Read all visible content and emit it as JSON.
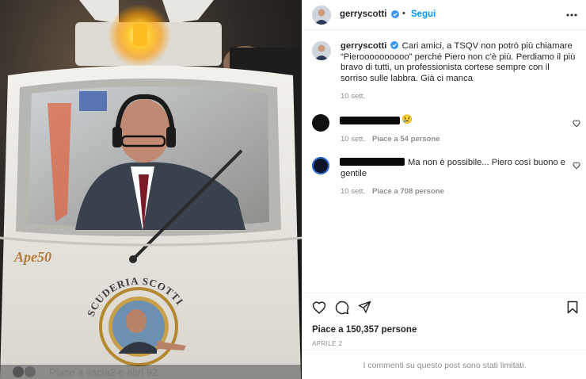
{
  "post": {
    "username": "gerryscotti",
    "follow_label": "Segui",
    "dot": "•",
    "verified": true,
    "icons": {
      "verified": "verified-badge-icon",
      "more": "more-options-icon"
    }
  },
  "caption": {
    "username": "gerryscotti",
    "text": "Cari amici, a TSQV non potrò più chiamare “Pieroooooooooo” perché Piero non c’è più. Perdiamo il più bravo di tutti, un professionista cortese sempre con il sorriso sulle labbra. Già ci manca",
    "time": "10 sett."
  },
  "comments": [
    {
      "emoji": "😢",
      "text": "",
      "time": "10 sett.",
      "likes": "Piace a 54 persone"
    },
    {
      "emoji": "",
      "text": "Ma non è possibile... Piero così buono e gentile",
      "time": "10 sett.",
      "likes": "Piace a 708 persone"
    }
  ],
  "actions": {
    "icons": [
      "heart-icon",
      "comment-icon",
      "share-icon",
      "bookmark-icon"
    ]
  },
  "stats": {
    "likes": "Piace a 150,357 persone",
    "date": "APRILE 2"
  },
  "limited_notice": "I commenti su questo post sono stati limitati.",
  "photo": {
    "vehicle_text_model": "Ape50",
    "vehicle_text_brand": "SCUDERIA SCOTTI",
    "overlay_text": "Piace a iiacia2 e altri 92"
  },
  "colors": {
    "accent": "#0095f6",
    "text": "#262626",
    "muted": "#8e8e8e",
    "border": "#efefef"
  }
}
